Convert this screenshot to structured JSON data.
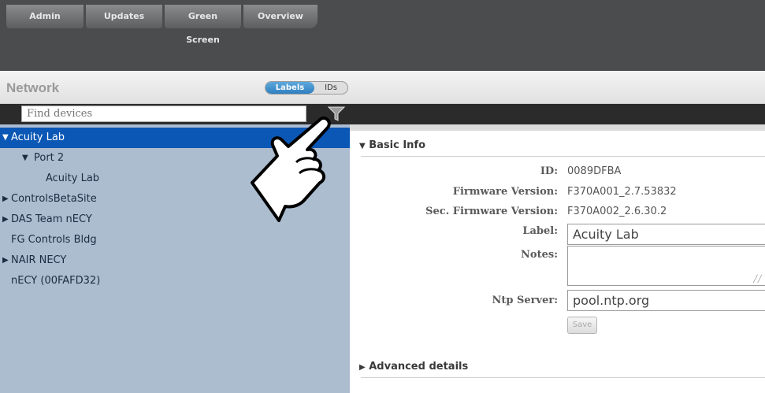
{
  "top_tabs": [
    "Admin",
    "Updates",
    "Green Screen",
    "Overview"
  ],
  "left_panel": {
    "title": "Network",
    "view_toggle": {
      "active": "Labels",
      "inactive": "IDs"
    },
    "search": {
      "placeholder": "Find devices",
      "value": ""
    },
    "filter_icon": "funnel-icon",
    "tree": [
      {
        "label": "Acuity Lab",
        "arrow": "▼",
        "selected": true
      },
      {
        "label": "Port 2",
        "arrow": "▼",
        "selected": false
      },
      {
        "label": "Acuity Lab",
        "arrow": "",
        "selected": false
      },
      {
        "label": "ControlsBetaSite",
        "arrow": "▶",
        "selected": false
      },
      {
        "label": "DAS Team nECY",
        "arrow": "▶",
        "selected": false
      },
      {
        "label": "FG Controls Bldg",
        "arrow": "",
        "selected": false
      },
      {
        "label": "NAIR NECY",
        "arrow": "▶",
        "selected": false
      },
      {
        "label": "nECY (00FAFD32)",
        "arrow": "",
        "selected": false
      }
    ]
  },
  "detail": {
    "basic_info": {
      "header": "Basic Info",
      "arrow": "▼",
      "id_label": "ID:",
      "id_value": "0089DFBA",
      "firmware_label": "Firmware Version:",
      "firmware_value": "F370A001_2.7.53832",
      "sec_firmware_label": "Sec. Firmware Version:",
      "sec_firmware_value": "F370A002_2.6.30.2",
      "label_label": "Label:",
      "label_value": "Acuity Lab",
      "notes_label": "Notes:",
      "notes_value": "",
      "ntp_label": "Ntp Server:",
      "ntp_value": "pool.ntp.org",
      "save_label": "Save"
    },
    "advanced": {
      "header": "Advanced details",
      "arrow": "▶"
    }
  },
  "colors": {
    "topbar": "#4b4c4e",
    "tree_bg": "#adbdd0",
    "selection": "#0b57b5",
    "toggle_active": "#2f7fc0"
  },
  "overlay_icon": "pointing-hand-icon"
}
